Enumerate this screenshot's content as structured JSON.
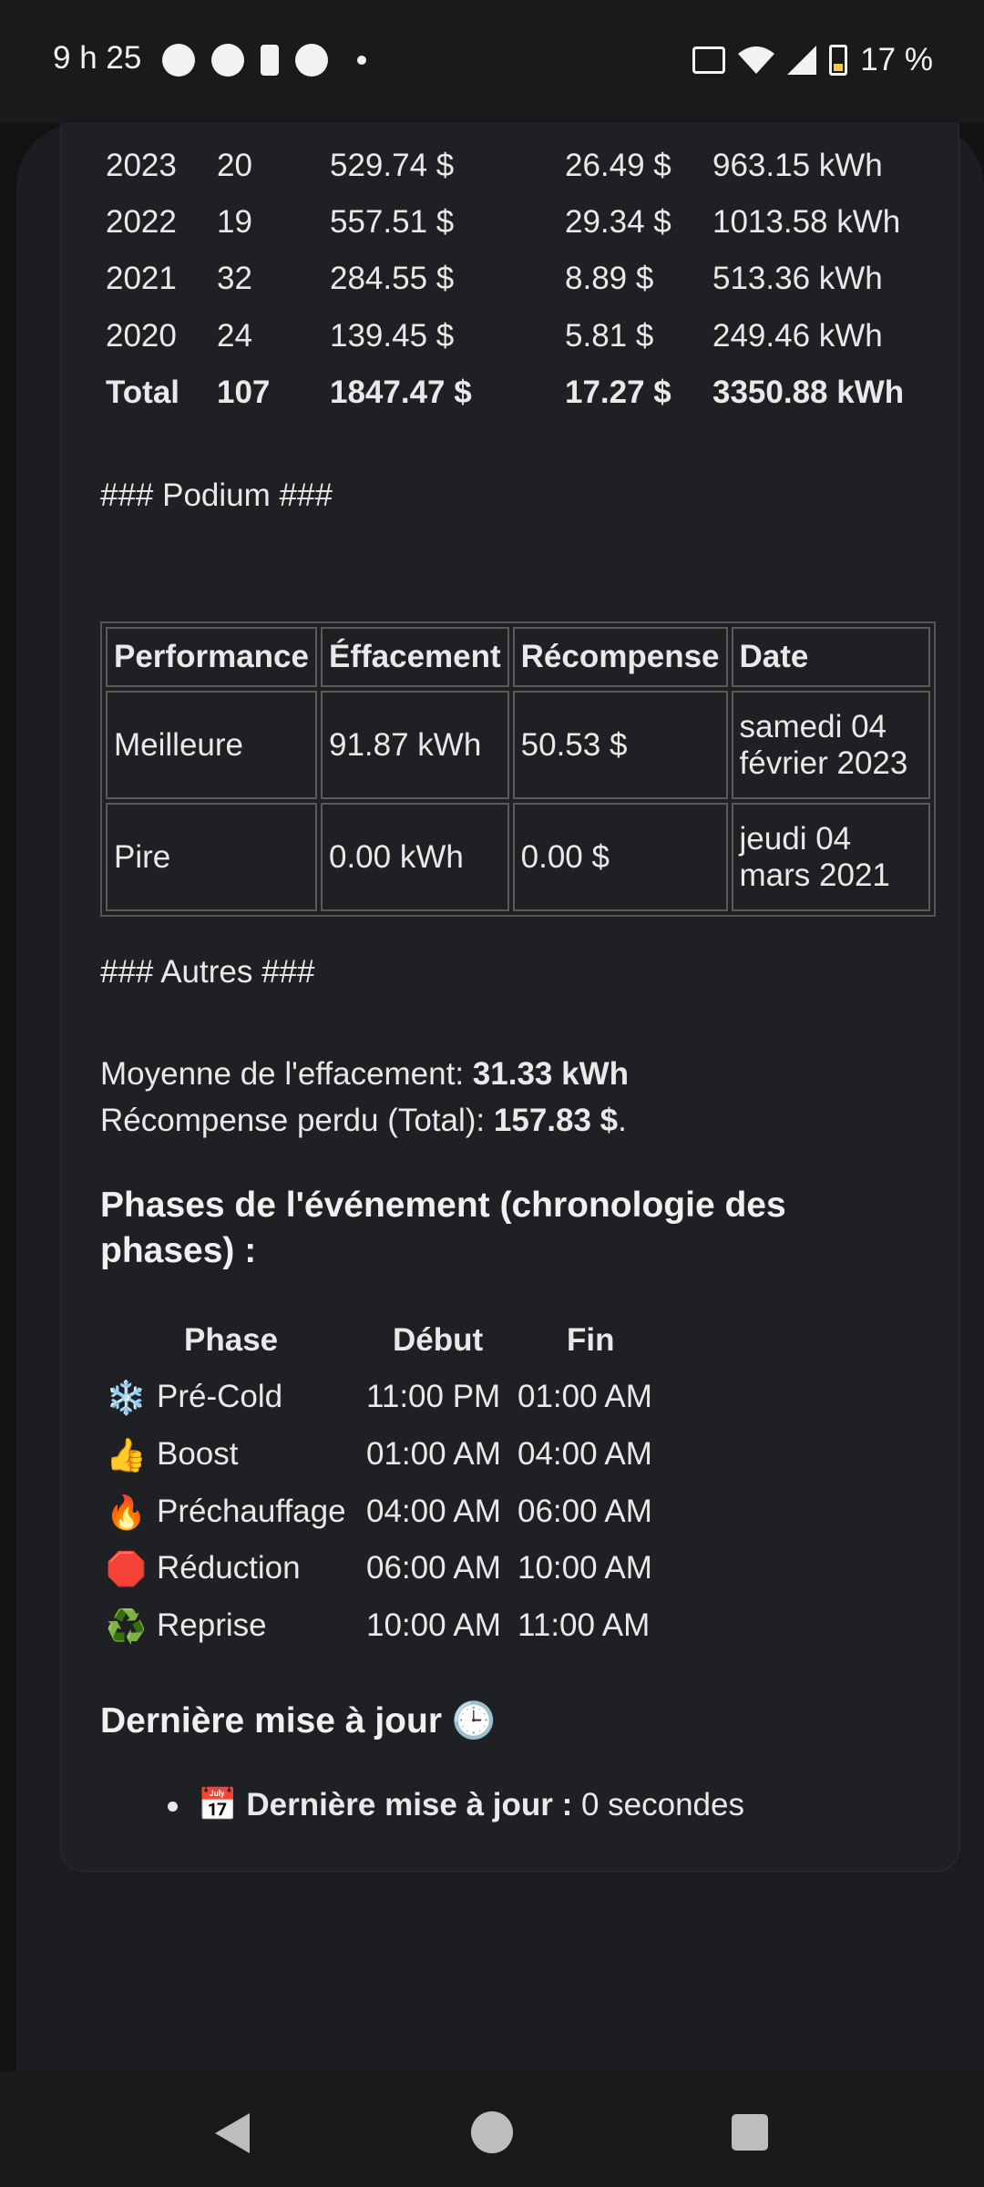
{
  "status_bar": {
    "time": "9 h 25",
    "battery_percent": "17 %",
    "left_icons": [
      "messenger-icon",
      "cookie-icon",
      "battery-saver-icon",
      "incognito-icon",
      "dot-icon"
    ],
    "right_icons": [
      "vibrate-icon",
      "wifi-icon",
      "signal-icon",
      "battery-icon"
    ]
  },
  "year_table": {
    "rows": [
      {
        "year": "2023",
        "count": "20",
        "reward": "529.74 $",
        "avg": "26.49 $",
        "energy": "963.15 kWh"
      },
      {
        "year": "2022",
        "count": "19",
        "reward": "557.51 $",
        "avg": "29.34 $",
        "energy": "1013.58 kWh"
      },
      {
        "year": "2021",
        "count": "32",
        "reward": "284.55 $",
        "avg": "8.89 $",
        "energy": "513.36 kWh"
      },
      {
        "year": "2020",
        "count": "24",
        "reward": "139.45 $",
        "avg": "5.81 $",
        "energy": "249.46 kWh"
      }
    ],
    "total": {
      "year": "Total",
      "count": "107",
      "reward": "1847.47 $",
      "avg": "17.27 $",
      "energy": "3350.88 kWh"
    }
  },
  "podium": {
    "heading": "### Podium ###",
    "headers": [
      "Performance",
      "Éffacement",
      "Récompense",
      "Date"
    ],
    "rows": [
      {
        "performance": "Meilleure",
        "effacement": "91.87 kWh",
        "recompense": "50.53 $",
        "date": "samedi 04 février 2023"
      },
      {
        "performance": "Pire",
        "effacement": "0.00 kWh",
        "recompense": "0.00 $",
        "date": "jeudi 04 mars 2021"
      }
    ]
  },
  "autres": {
    "heading": "### Autres ###",
    "avg_label": "Moyenne de l'effacement: ",
    "avg_value": "31.33 kWh",
    "lost_label": "Récompense perdu (Total): ",
    "lost_value": "157.83 $",
    "lost_suffix": "."
  },
  "phases": {
    "title": "Phases de l'événement (chronologie des phases) :",
    "headers": [
      "Phase",
      "Début",
      "Fin"
    ],
    "rows": [
      {
        "emoji": "❄️",
        "icon": "snowflake-icon",
        "name": "Pré-Cold",
        "start": "11:00 PM",
        "end": "01:00 AM"
      },
      {
        "emoji": "👍",
        "icon": "thumbs-up-icon",
        "name": "Boost",
        "start": "01:00 AM",
        "end": "04:00 AM"
      },
      {
        "emoji": "🔥",
        "icon": "fire-icon",
        "name": "Préchauffage",
        "start": "04:00 AM",
        "end": "06:00 AM"
      },
      {
        "emoji": "🛑",
        "icon": "stop-sign-icon",
        "name": "Réduction",
        "start": "06:00 AM",
        "end": "10:00 AM"
      },
      {
        "emoji": "♻️",
        "icon": "recycle-icon",
        "name": "Reprise",
        "start": "10:00 AM",
        "end": "11:00 AM"
      }
    ]
  },
  "last_update": {
    "title": "Dernière mise à jour 🕒",
    "calendar_emoji": "📅",
    "label": "Dernière mise à jour :",
    "value": " 0 secondes"
  },
  "colors": {
    "background": "#111214",
    "card": "#1f2023",
    "text": "#e9e9e9",
    "battery_accent": "#f6c744"
  }
}
